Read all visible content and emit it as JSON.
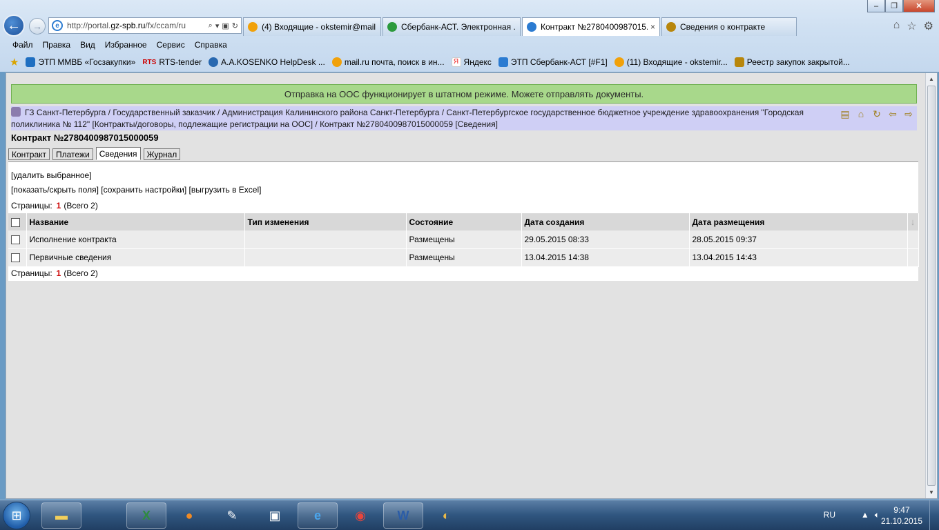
{
  "browser": {
    "address_url_prefix": "http://portal.",
    "address_url_domain": "gz-spb.ru",
    "address_url_path": "/fx/ccam/ru",
    "tabs": [
      {
        "label": "(4) Входящие - okstemir@mail...",
        "icon_color": "#f1a10a"
      },
      {
        "label": "Сбербанк-АСТ. Электронная ...",
        "icon_color": "#2c9a3d"
      },
      {
        "label": "Контракт №27804009870​15...",
        "icon_color": "#2b7bd1"
      },
      {
        "label": "Сведения о контракте",
        "icon_color": "#b8860b"
      }
    ],
    "close_tab_glyph": "×"
  },
  "menu": [
    "Файл",
    "Правка",
    "Вид",
    "Избранное",
    "Сервис",
    "Справка"
  ],
  "favorites": [
    {
      "label": "ЭТП ММВБ «Госзакупки»",
      "icon": "mmvb-icon",
      "color": "#1f6fc1"
    },
    {
      "label": "RTS-tender",
      "icon": "rts-icon",
      "prefix": "RTS",
      "color": "#c00000"
    },
    {
      "label": "А.А.KOSENKO  HelpDesk ...",
      "icon": "helpdesk-icon",
      "color": "#2868b0"
    },
    {
      "label": "mail.ru почта, поиск в ин...",
      "icon": "mailru-icon",
      "color": "#f1a10a"
    },
    {
      "label": "Яндекс",
      "icon": "yandex-icon",
      "color": "#e22"
    },
    {
      "label": "ЭТП Сбербанк-АСТ [#F1]",
      "icon": "sberbank-icon",
      "color": "#2b7bd1"
    },
    {
      "label": "(11) Входящие - okstemir...",
      "icon": "mailru-icon",
      "color": "#f1a10a"
    },
    {
      "label": "Реестр закупок закрытой...",
      "icon": "emblem-icon",
      "color": "#b8860b"
    }
  ],
  "page": {
    "banner": "Отправка на ООС функционирует в штатном режиме. Можете отправлять документы.",
    "breadcrumb": "ГЗ Санкт-Петербурга / Государственный заказчик / Администрация Калининского района Санкт-Петербурга / Санкт-Петербургское государственное бюджетное учреждение здравоохранения \"Городская поликлиника № 112\" [Контракты/договоры, подлежащие регистрации на ООС] / Контракт №2780400987015000059 [Сведения]",
    "title": "Контракт №2780400987015000059",
    "tabs": [
      "Контракт",
      "Платежи",
      "Сведения",
      "Журнал"
    ],
    "active_tab": "Сведения",
    "action_delete": "[удалить выбранное]",
    "action_showhide": "[показать/скрыть поля]",
    "action_save": "[сохранить настройки]",
    "action_excel": "[выгрузить в Excel]",
    "pager_label": "Страницы:",
    "pager_current": "1",
    "pager_total": "(Всего 2)",
    "columns": [
      "Название",
      "Тип изменения",
      "Состояние",
      "Дата создания",
      "Дата размещения"
    ],
    "rows": [
      {
        "name": "Исполнение контракта",
        "change_type": "",
        "state": "Размещены",
        "created": "29.05.2015 08:33",
        "placed": "28.05.2015 09:37"
      },
      {
        "name": "Первичные сведения",
        "change_type": "",
        "state": "Размещены",
        "created": "13.04.2015 14:38",
        "placed": "13.04.2015 14:43"
      }
    ]
  },
  "taskbar": {
    "lang": "RU",
    "time": "9:47",
    "date": "21.10.2015"
  }
}
